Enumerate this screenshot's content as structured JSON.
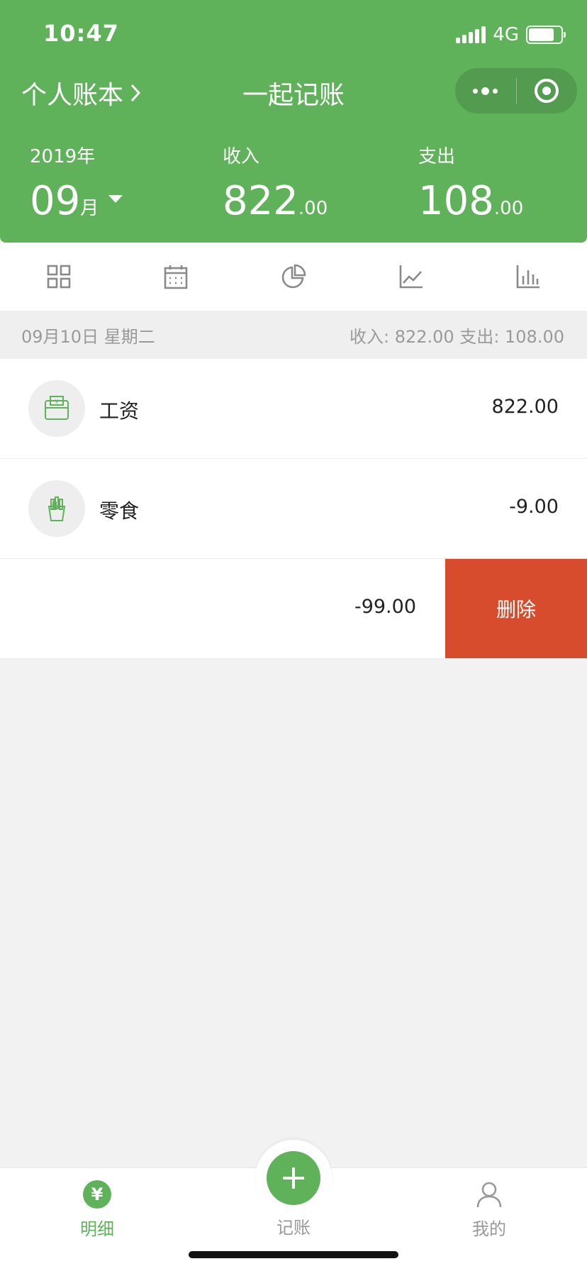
{
  "status_bar": {
    "time": "10:47",
    "network": "4G"
  },
  "nav": {
    "book_label": "个人账本",
    "title": "一起记账"
  },
  "summary": {
    "year_label": "2019年",
    "month_number": "09",
    "month_suffix": "月",
    "income_label": "收入",
    "income_int": "822",
    "income_dec": ".00",
    "expense_label": "支出",
    "expense_int": "108",
    "expense_dec": ".00"
  },
  "toolbar": [
    "grid-icon",
    "calendar-icon",
    "pie-chart-icon",
    "line-chart-icon",
    "bar-chart-icon"
  ],
  "date_group": {
    "date": "09月10日 星期二",
    "totals": "收入: 822.00 支出: 108.00"
  },
  "records": [
    {
      "category": "工资",
      "amount": "822.00",
      "icon": "wallet-icon"
    },
    {
      "category": "零食",
      "amount": "-9.00",
      "icon": "snack-icon"
    },
    {
      "category": "",
      "amount": "-99.00",
      "delete_label": "删除"
    }
  ],
  "tabbar": {
    "detail": "明细",
    "record": "记账",
    "mine": "我的",
    "detail_icon_text": "¥"
  },
  "colors": {
    "brand": "#5fb25a",
    "delete": "#d84c2e"
  }
}
